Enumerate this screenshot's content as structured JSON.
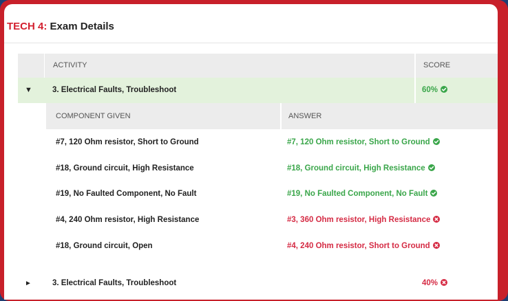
{
  "header": {
    "prefix": "TECH 4:",
    "title": "Exam Details"
  },
  "columns": {
    "activity": "ACTIVITY",
    "score": "SCORE",
    "component_given": "COMPONENT GIVEN",
    "answer": "ANSWER"
  },
  "activities": [
    {
      "toggle": "▼",
      "name": "3. Electrical Faults, Troubleshoot",
      "score": "60%",
      "status": "correct",
      "expanded": true,
      "details": [
        {
          "component": "#7, 120 Ohm resistor, Short to Ground",
          "answer": "#7, 120 Ohm resistor, Short to Ground",
          "status": "correct"
        },
        {
          "component": "#18, Ground circuit, High Resistance",
          "answer": "#18, Ground circuit, High Resistance",
          "status": "correct"
        },
        {
          "component": "#19, No Faulted Component, No Fault",
          "answer": "#19, No Faulted Component, No Fault",
          "status": "correct"
        },
        {
          "component": "#4, 240 Ohm resistor, High Resistance",
          "answer": "#3, 360 Ohm resistor, High Resistance",
          "status": "incorrect"
        },
        {
          "component": "#18, Ground circuit, Open",
          "answer": "#4, 240 Ohm resistor, Short to Ground",
          "status": "incorrect"
        }
      ]
    },
    {
      "toggle": "►",
      "name": "3. Electrical Faults, Troubleshoot",
      "score": "40%",
      "status": "incorrect",
      "expanded": false
    }
  ],
  "colors": {
    "accent_red": "#d3202f",
    "correct_green": "#3aa64a",
    "incorrect_red": "#d52b44",
    "frame_red": "#c8202a",
    "background_blue": "#1f3f73"
  },
  "icons": {
    "correct": "check-circle-icon",
    "incorrect": "x-circle-icon"
  }
}
